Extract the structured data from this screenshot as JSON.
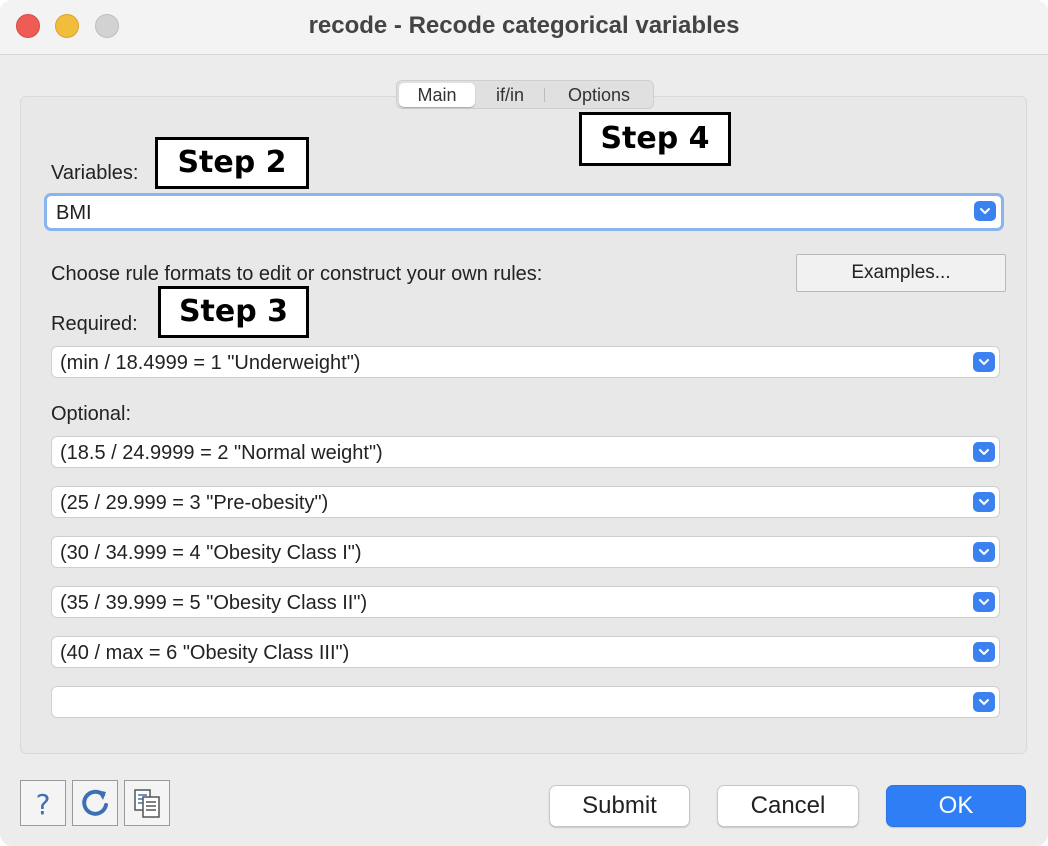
{
  "window": {
    "title": "recode - Recode categorical variables"
  },
  "tabs": [
    {
      "label": "Main",
      "selected": true
    },
    {
      "label": "if/in",
      "selected": false
    },
    {
      "label": "Options",
      "selected": false
    }
  ],
  "annotations": {
    "step2": "Step 2",
    "step3": "Step 3",
    "step4": "Step 4"
  },
  "variables": {
    "label": "Variables:",
    "value": "BMI"
  },
  "rules": {
    "instruction": "Choose rule formats to edit or construct your own rules:",
    "examples_button": "Examples...",
    "required_label": "Required:",
    "required_value": "(min / 18.4999 = 1 \"Underweight\")",
    "optional_label": "Optional:",
    "optional_values": [
      "(18.5 / 24.9999 = 2 \"Normal weight\")",
      "(25 / 29.999 = 3 \"Pre-obesity\")",
      "(30 / 34.999 = 4 \"Obesity Class I\")",
      "(35 / 39.999 = 5 \"Obesity Class II\")",
      "(40 / max = 6 \"Obesity Class III\")",
      ""
    ]
  },
  "footer": {
    "help_icon": "help-icon",
    "reset_icon": "reset-icon",
    "copy_icon": "copy-command-icon",
    "submit_label": "Submit",
    "cancel_label": "Cancel",
    "ok_label": "OK"
  },
  "colors": {
    "accent": "#2f7ef5",
    "focus_ring": "#8ab4f0",
    "close": "#ee5c55",
    "minimize": "#f2bd3d",
    "maximize": "#d2d2d2"
  }
}
